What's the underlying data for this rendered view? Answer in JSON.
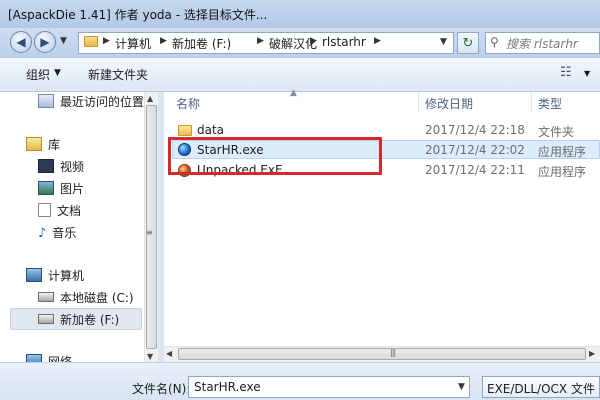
{
  "window": {
    "title": "[AspackDie 1.41] 作者 yoda - 选择目标文件..."
  },
  "address": {
    "crumbs": [
      "计算机",
      "新加卷 (F:)",
      "破解汉化",
      "rlstarhr"
    ],
    "search_placeholder": "搜索 rlstarhr"
  },
  "toolbar": {
    "organize": "组织",
    "new_folder": "新建文件夹"
  },
  "nav": {
    "recent": "最近访问的位置",
    "libraries": "库",
    "videos": "视频",
    "pictures": "图片",
    "documents": "文档",
    "music": "音乐",
    "computer": "计算机",
    "local_disk": "本地磁盘 (C:)",
    "new_volume": "新加卷 (F:)",
    "network": "网络"
  },
  "columns": {
    "name": "名称",
    "date": "修改日期",
    "type": "类型"
  },
  "files": [
    {
      "name": "data",
      "date": "2017/12/4 22:18",
      "type": "文件夹"
    },
    {
      "name": "StarHR.exe",
      "date": "2017/12/4 22:02",
      "type": "应用程序"
    },
    {
      "name": "Unpacked.ExE",
      "date": "2017/12/4 22:11",
      "type": "应用程序"
    }
  ],
  "bottom": {
    "filename_label": "文件名(N):",
    "filename_value": "StarHR.exe",
    "filter": "EXE/DLL/OCX 文件"
  },
  "colors": {
    "highlight": "#d42a2a",
    "selection": "#ddecfd"
  }
}
